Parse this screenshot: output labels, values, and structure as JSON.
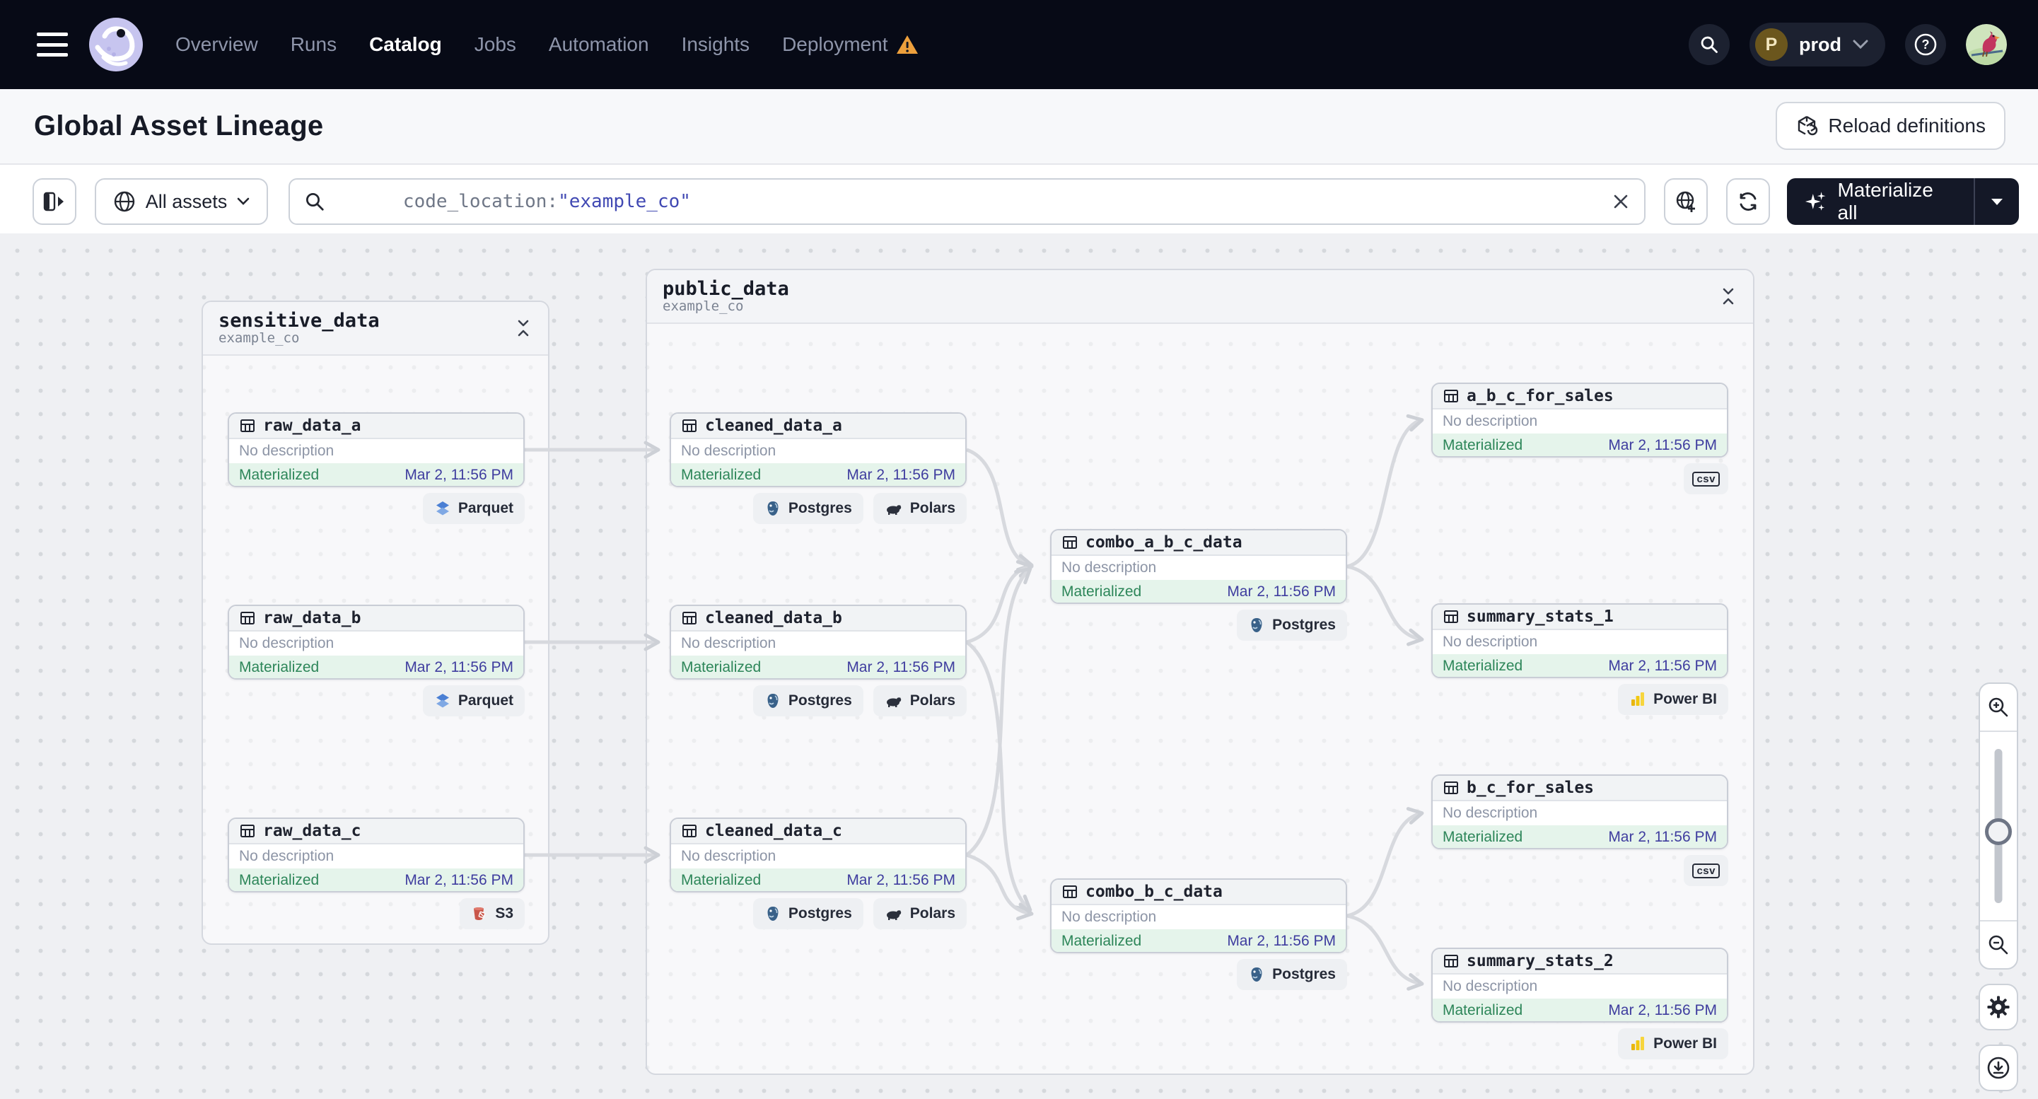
{
  "nav": {
    "items": [
      {
        "label": "Overview",
        "active": false
      },
      {
        "label": "Runs",
        "active": false
      },
      {
        "label": "Catalog",
        "active": true
      },
      {
        "label": "Jobs",
        "active": false
      },
      {
        "label": "Automation",
        "active": false
      },
      {
        "label": "Insights",
        "active": false
      },
      {
        "label": "Deployment",
        "active": false,
        "warning": true
      }
    ],
    "deployment_switcher": {
      "badge": "P",
      "label": "prod"
    }
  },
  "header": {
    "title": "Global Asset Lineage",
    "reload_button": "Reload definitions"
  },
  "toolbar": {
    "scope_button": "All assets",
    "search_field": "code_location:",
    "search_value": "\"example_co\"",
    "materialize_button": "Materialize all"
  },
  "graph": {
    "groups": [
      {
        "name": "sensitive_data",
        "location": "example_co"
      },
      {
        "name": "public_data",
        "location": "example_co"
      }
    ],
    "nodes": [
      {
        "name": "raw_data_a",
        "description": "No description",
        "status": "Materialized",
        "timestamp": "Mar 2, 11:56 PM",
        "tags": [
          {
            "label": "Parquet",
            "icon": "parquet-icon"
          }
        ]
      },
      {
        "name": "raw_data_b",
        "description": "No description",
        "status": "Materialized",
        "timestamp": "Mar 2, 11:56 PM",
        "tags": [
          {
            "label": "Parquet",
            "icon": "parquet-icon"
          }
        ]
      },
      {
        "name": "raw_data_c",
        "description": "No description",
        "status": "Materialized",
        "timestamp": "Mar 2, 11:56 PM",
        "tags": [
          {
            "label": "S3",
            "icon": "s3-icon"
          }
        ]
      },
      {
        "name": "cleaned_data_a",
        "description": "No description",
        "status": "Materialized",
        "timestamp": "Mar 2, 11:56 PM",
        "tags": [
          {
            "label": "Postgres",
            "icon": "postgres-icon"
          },
          {
            "label": "Polars",
            "icon": "polars-icon"
          }
        ]
      },
      {
        "name": "cleaned_data_b",
        "description": "No description",
        "status": "Materialized",
        "timestamp": "Mar 2, 11:56 PM",
        "tags": [
          {
            "label": "Postgres",
            "icon": "postgres-icon"
          },
          {
            "label": "Polars",
            "icon": "polars-icon"
          }
        ]
      },
      {
        "name": "cleaned_data_c",
        "description": "No description",
        "status": "Materialized",
        "timestamp": "Mar 2, 11:56 PM",
        "tags": [
          {
            "label": "Postgres",
            "icon": "postgres-icon"
          },
          {
            "label": "Polars",
            "icon": "polars-icon"
          }
        ]
      },
      {
        "name": "combo_a_b_c_data",
        "description": "No description",
        "status": "Materialized",
        "timestamp": "Mar 2, 11:56 PM",
        "tags": [
          {
            "label": "Postgres",
            "icon": "postgres-icon"
          }
        ]
      },
      {
        "name": "combo_b_c_data",
        "description": "No description",
        "status": "Materialized",
        "timestamp": "Mar 2, 11:56 PM",
        "tags": [
          {
            "label": "Postgres",
            "icon": "postgres-icon"
          }
        ]
      },
      {
        "name": "a_b_c_for_sales",
        "description": "No description",
        "status": "Materialized",
        "timestamp": "Mar 2, 11:56 PM",
        "tags": [
          {
            "label": "csv",
            "icon": "csv-icon"
          }
        ]
      },
      {
        "name": "summary_stats_1",
        "description": "No description",
        "status": "Materialized",
        "timestamp": "Mar 2, 11:56 PM",
        "tags": [
          {
            "label": "Power BI",
            "icon": "powerbi-icon"
          }
        ]
      },
      {
        "name": "b_c_for_sales",
        "description": "No description",
        "status": "Materialized",
        "timestamp": "Mar 2, 11:56 PM",
        "tags": [
          {
            "label": "csv",
            "icon": "csv-icon"
          }
        ]
      },
      {
        "name": "summary_stats_2",
        "description": "No description",
        "status": "Materialized",
        "timestamp": "Mar 2, 11:56 PM",
        "tags": [
          {
            "label": "Power BI",
            "icon": "powerbi-icon"
          }
        ]
      }
    ]
  },
  "colors": {
    "nav_bg": "#070a16",
    "accent_indigo": "#3f3d9f",
    "status_green": "#2d8659",
    "status_green_bg": "#e5f4eb",
    "warning_orange": "#eda03c",
    "brand_lavender": "#c7c5ef",
    "powerbi_yellow": "#f2c811",
    "postgres_blue": "#396189",
    "parquet_blue": "#4a7fd4",
    "s3_red": "#c9564a"
  }
}
